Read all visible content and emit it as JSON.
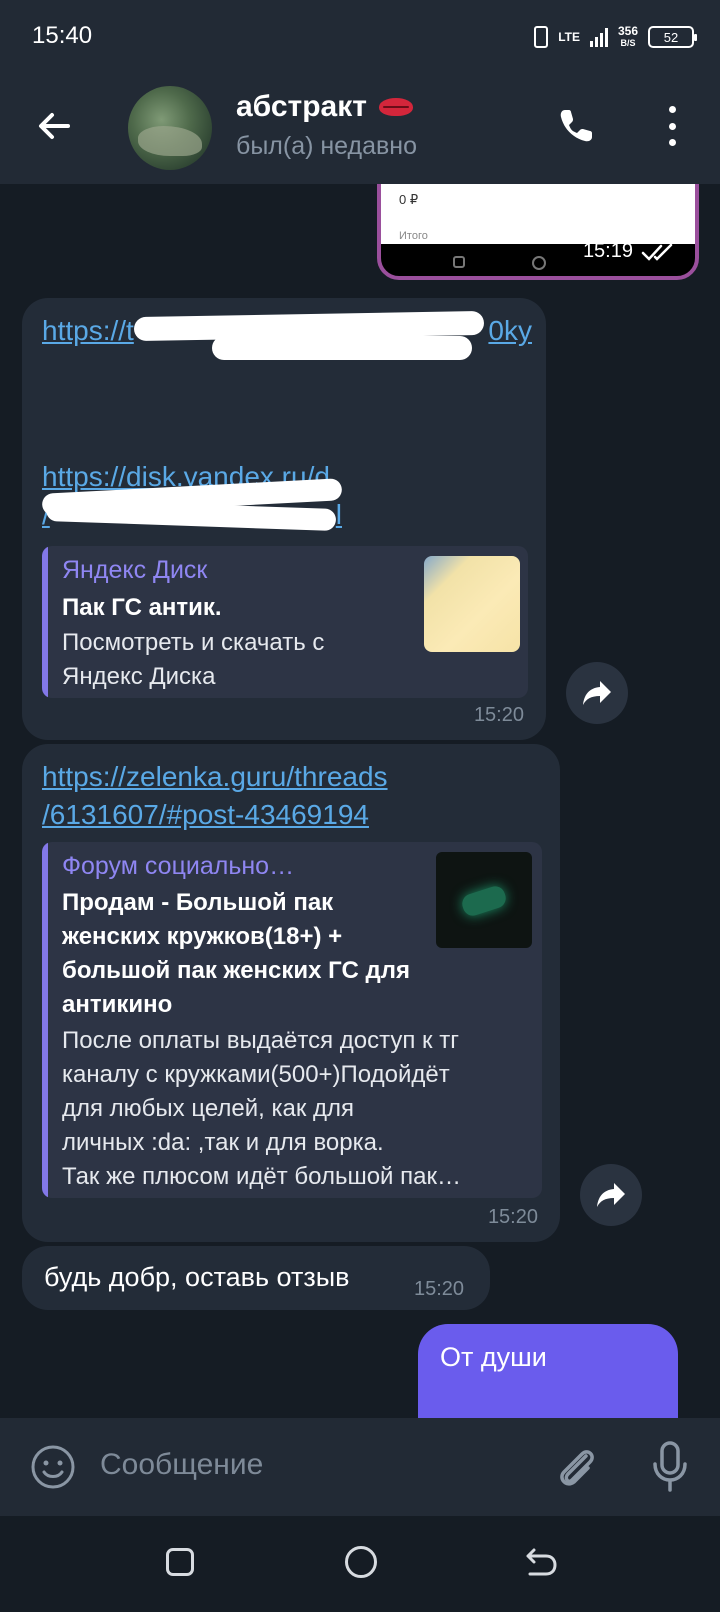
{
  "status_bar": {
    "time": "15:40",
    "network": "LTE",
    "network_sub": "1l",
    "speed_value": "356",
    "speed_unit": "B/S",
    "battery": "52"
  },
  "header": {
    "contact_name": "абстракт",
    "contact_emoji": "kiss-mark-icon",
    "status": "был(а) недавно"
  },
  "messages": {
    "image_message": {
      "price_text": "0 ₽",
      "total_label": "Итого",
      "time": "15:19"
    },
    "link_message_1": {
      "link_1": "https://t",
      "link_1_end": "0ky",
      "link_2_line1": "https://disk.yandex.ru/d",
      "link_2_line2": "/",
      "link_2_end": "l",
      "preview_site": "Яндекс Диск",
      "preview_title": "Пак ГС антик.",
      "preview_desc_1": "Посмотреть и скачать с",
      "preview_desc_2": "Яндекс Диска",
      "time": "15:20"
    },
    "link_message_2": {
      "link_line1": "https://zelenka.guru/threads",
      "link_line2": "/6131607/#post-43469194",
      "preview_site": "Форум социально…",
      "preview_title_1": "Продам - Большой пак",
      "preview_title_2": "женских кружков(18+) +",
      "preview_title_3": "большой пак женских ГС для",
      "preview_title_4": "антикино",
      "preview_desc_1": "После оплаты выдаётся доступ к тг",
      "preview_desc_2": "каналу с кружками(500+)Подойдёт",
      "preview_desc_3": "для любых целей, как для",
      "preview_desc_4": "личных :da: ,так и для ворка.",
      "preview_desc_5": "Так же плюсом идёт большой пак…",
      "time": "15:20"
    },
    "text_message": {
      "text": "будь добр, оставь отзыв",
      "time": "15:20"
    },
    "outgoing_message": {
      "text": "От души"
    }
  },
  "input": {
    "placeholder": "Сообщение"
  },
  "colors": {
    "background": "#151c24",
    "header": "#222a35",
    "incoming_bubble": "#232c38",
    "outgoing_bubble": "#6a5ced",
    "link": "#5aa9e6",
    "accent": "#8378e8"
  }
}
